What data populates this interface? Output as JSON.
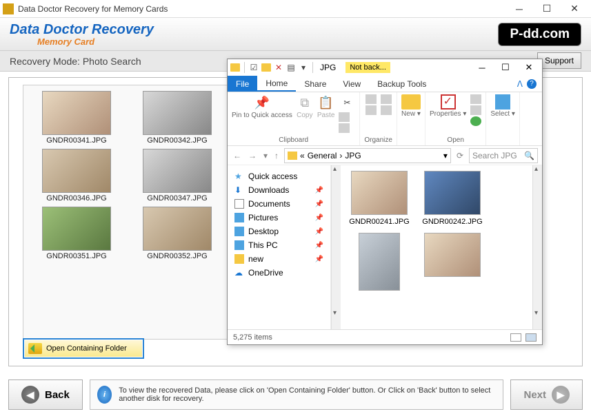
{
  "titlebar": {
    "title": "Data Doctor Recovery for Memory Cards"
  },
  "brand": {
    "title": "Data Doctor Recovery",
    "subtitle": "Memory Card",
    "site": "P-dd.com"
  },
  "mode_bar": {
    "text": "Recovery Mode: Photo Search",
    "support": "Support"
  },
  "thumbs": [
    {
      "label": "GNDR00341.JPG"
    },
    {
      "label": "GNDR00342.JPG"
    },
    {
      "label": "GNDR00346.JPG"
    },
    {
      "label": "GNDR00347.JPG"
    },
    {
      "label": "GNDR00351.JPG"
    },
    {
      "label": "GNDR00352.JPG"
    }
  ],
  "ocf": {
    "label": "Open Containing Folder"
  },
  "bottom": {
    "back": "Back",
    "next": "Next",
    "hint": "To view the recovered Data, please click on 'Open Containing Folder' button. Or Click on 'Back' button to select another disk for recovery."
  },
  "explorer": {
    "path_title": "JPG",
    "not_backed": "Not back...",
    "tabs": {
      "file": "File",
      "home": "Home",
      "share": "Share",
      "view": "View",
      "backup": "Backup Tools"
    },
    "ribbon": {
      "pin": "Pin to Quick access",
      "copy": "Copy",
      "paste": "Paste",
      "clipboard": "Clipboard",
      "organize": "Organize",
      "new": "New",
      "properties": "Properties",
      "open": "Open",
      "select": "Select"
    },
    "address": {
      "root": "General",
      "current": "JPG",
      "search": "Search JPG"
    },
    "nav": [
      {
        "label": "Quick access",
        "icon": "star"
      },
      {
        "label": "Downloads",
        "icon": "dl",
        "pin": true
      },
      {
        "label": "Documents",
        "icon": "doc",
        "pin": true
      },
      {
        "label": "Pictures",
        "icon": "pic",
        "pin": true
      },
      {
        "label": "Desktop",
        "icon": "desk",
        "pin": true
      },
      {
        "label": "This PC",
        "icon": "pc",
        "pin": true
      },
      {
        "label": "new",
        "icon": "fold",
        "pin": true
      },
      {
        "label": "OneDrive",
        "icon": "od"
      }
    ],
    "files": [
      {
        "label": "GNDR00241.JPG"
      },
      {
        "label": "GNDR00242.JPG"
      },
      {
        "label": ""
      },
      {
        "label": ""
      }
    ],
    "status": {
      "count": "5,275 items"
    }
  }
}
